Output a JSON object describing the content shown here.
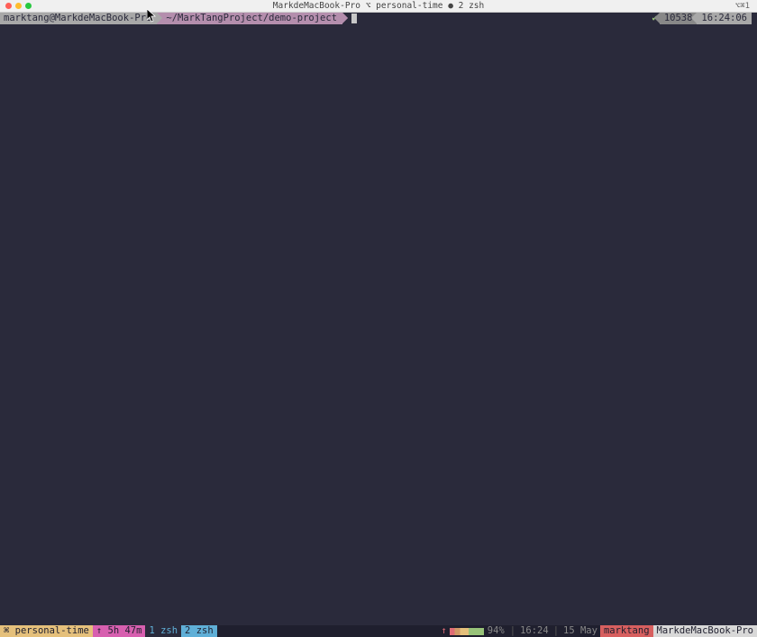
{
  "window": {
    "title": "MarkdeMacBook-Pro ⌥ personal-time ● 2 zsh",
    "right_indicator": "⌥⌘1"
  },
  "prompt": {
    "userhost": "marktang@MarkdeMacBook-Pro",
    "path": "~/MarkTangProject/demo-project",
    "right_check": "✔",
    "right_number": "10538",
    "right_time": "16:24:06"
  },
  "statusbar": {
    "session_prefix": "⌘",
    "session": "personal-time",
    "uptime_prefix": "↑",
    "uptime": "5h 47m",
    "window1": "1 zsh",
    "window2": "2 zsh",
    "net_arrow": "↑",
    "battery_pct": "94%",
    "sep": "|",
    "clock": "16:24",
    "date": "15 May",
    "user": "marktang",
    "host": "MarkdeMacBook-Pro"
  }
}
